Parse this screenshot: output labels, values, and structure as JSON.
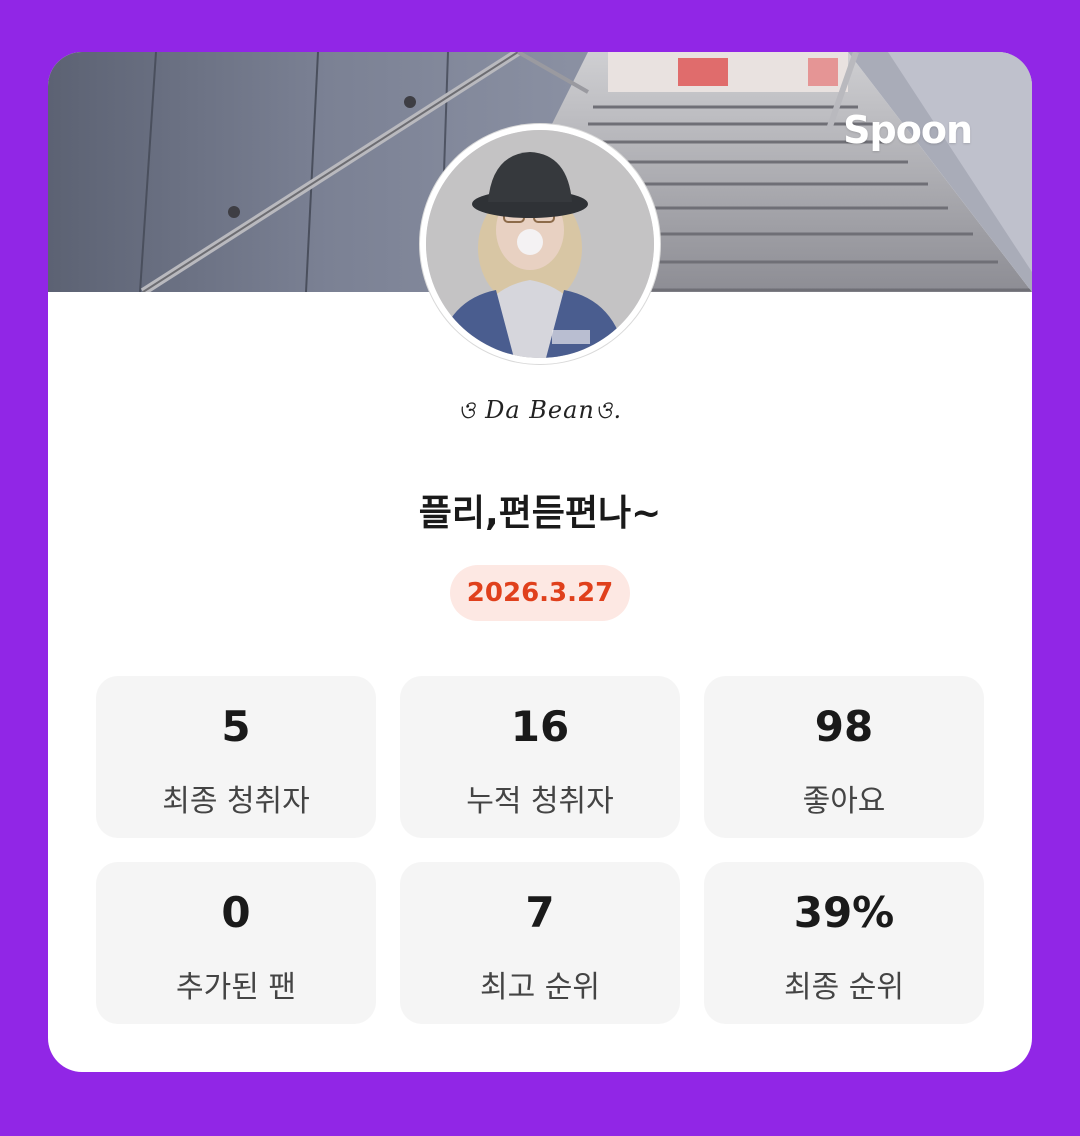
{
  "brand": "Spoon",
  "profile": {
    "nickname": "ও Da Beanও."
  },
  "broadcast": {
    "title": "플리,편듣편나~",
    "date": "2026.3.27"
  },
  "stats": [
    {
      "value": "5",
      "label": "최종 청취자"
    },
    {
      "value": "16",
      "label": "누적 청취자"
    },
    {
      "value": "98",
      "label": "좋아요"
    },
    {
      "value": "0",
      "label": "추가된 팬"
    },
    {
      "value": "7",
      "label": "최고 순위"
    },
    {
      "value": "39%",
      "label": "최종 순위"
    }
  ],
  "colors": {
    "background": "#9126e6",
    "card": "#ffffff",
    "date_badge_bg": "#fde8e3",
    "date_badge_text": "#e0401c",
    "stat_tile_bg": "#f5f5f5"
  }
}
